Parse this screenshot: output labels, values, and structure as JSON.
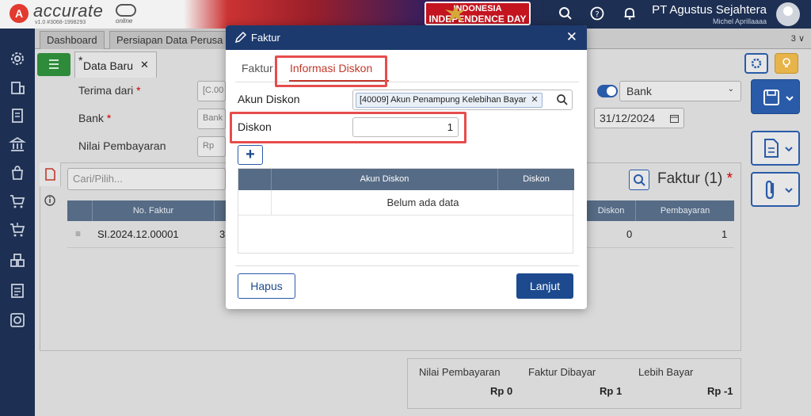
{
  "app": {
    "brand": "accurate",
    "brand_sub": "online",
    "version": "v1.0 #3068-1998293",
    "banner_line1": "INDONESIA",
    "banner_line2": "INDEPENDENCE DAY",
    "company": "PT Agustus Sejahtera",
    "user": "Michel Aprillaaaa"
  },
  "tabs": [
    {
      "label": "Dashboard"
    },
    {
      "label": "Persiapan Data Perusa"
    }
  ],
  "tab_count": "3 ∨",
  "form_tab": {
    "label": "Data Baru"
  },
  "background_form": {
    "terima_dari_label": "Terima dari",
    "terima_dari_value": "[C.00",
    "bank_label": "Bank",
    "bank_value": "Bank",
    "nilai_label": "Nilai Pembayaran",
    "nilai_value": "Rp",
    "bank_select": "Bank",
    "date": "31/12/2024",
    "search_placeholder": "Cari/Pilih...",
    "faktur_title": "Faktur (1)",
    "col_no_faktur": "No. Faktur",
    "col_diskon": "Diskon",
    "col_pembayaran": "Pembayaran",
    "row_no_faktur": "SI.2024.12.00001",
    "row_partial": "3",
    "row_diskon": "0",
    "row_pembayaran": "1",
    "summary_nilai_label": "Nilai Pembayaran",
    "summary_nilai_value": "Rp 0",
    "summary_faktur_label": "Faktur Dibayar",
    "summary_faktur_value": "Rp 1",
    "summary_lebih_label": "Lebih Bayar",
    "summary_lebih_value": "Rp -1"
  },
  "modal": {
    "title": "Faktur",
    "tabs": [
      {
        "label": "Faktur"
      },
      {
        "label": "Informasi Diskon"
      }
    ],
    "akun_diskon_label": "Akun Diskon",
    "akun_diskon_chip": "[40009] Akun Penampung Kelebihan Bayar",
    "diskon_label": "Diskon",
    "diskon_value": "1",
    "grid_headers": [
      "Akun Diskon",
      "Diskon"
    ],
    "grid_empty": "Belum ada data",
    "hapus": "Hapus",
    "lanjut": "Lanjut"
  },
  "colors": {
    "header": "#1d3a6e",
    "accent_red": "#c0392b",
    "highlight": "#e74c4c",
    "primary": "#1d4a8f"
  }
}
